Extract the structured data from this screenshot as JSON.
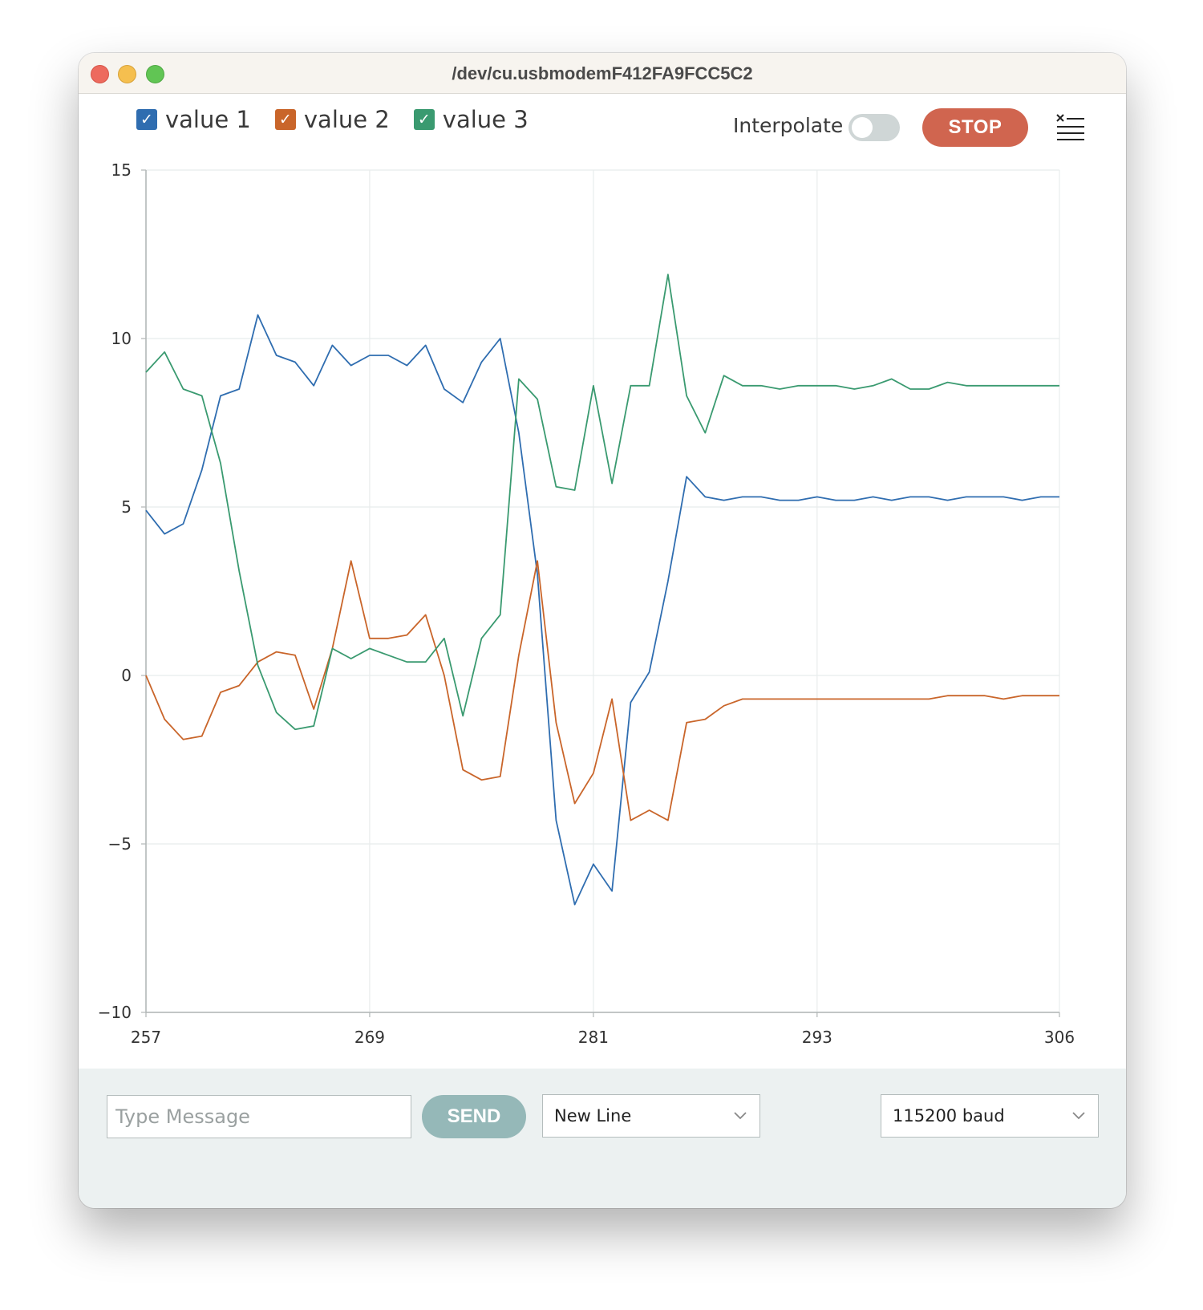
{
  "window": {
    "title": "/dev/cu.usbmodemF412FA9FCC5C2"
  },
  "toolbar": {
    "interpolate_label": "Interpolate",
    "interpolate_on": false,
    "stop_label": "STOP",
    "clear_icon": "clear-list-icon"
  },
  "legend": [
    {
      "label": "value 1",
      "color": "#2f6db0",
      "checked": true
    },
    {
      "label": "value 2",
      "color": "#c9652a",
      "checked": true
    },
    {
      "label": "value 3",
      "color": "#3a9a70",
      "checked": true
    }
  ],
  "chart_data": {
    "type": "line",
    "ylim": [
      -10,
      15
    ],
    "yticks": [
      "15",
      "10",
      "5",
      "0",
      "−10"
    ],
    "ytick_values": [
      15,
      10,
      5,
      0,
      -5,
      -10
    ],
    "ytick_labels": [
      "15",
      "10",
      "5",
      "0",
      "−5",
      "−10"
    ],
    "xlim": [
      257,
      306
    ],
    "xticks": [
      257,
      269,
      281,
      293,
      306
    ],
    "xtick_labels": [
      "257",
      "269",
      "281",
      "293",
      "306"
    ],
    "grid": true,
    "x": [
      257,
      258,
      259,
      260,
      261,
      262,
      263,
      264,
      265,
      266,
      267,
      268,
      269,
      270,
      271,
      272,
      273,
      274,
      275,
      276,
      277,
      278,
      279,
      280,
      281,
      282,
      283,
      284,
      285,
      286,
      287,
      288,
      289,
      290,
      291,
      292,
      293,
      294,
      295,
      296,
      297,
      298,
      299,
      300,
      301,
      302,
      303,
      304,
      305,
      306
    ],
    "series": [
      {
        "name": "value 1",
        "color": "#2f6db0",
        "values": [
          4.9,
          4.2,
          4.5,
          6.1,
          8.3,
          8.5,
          10.7,
          9.5,
          9.3,
          8.6,
          9.8,
          9.2,
          9.5,
          9.5,
          9.2,
          9.8,
          8.5,
          8.1,
          9.3,
          10.0,
          7.2,
          3.0,
          -4.3,
          -6.8,
          -5.6,
          -6.4,
          -0.8,
          0.1,
          2.8,
          5.9,
          5.3,
          5.2,
          5.3,
          5.3,
          5.2,
          5.2,
          5.3,
          5.2,
          5.2,
          5.3,
          5.2,
          5.3,
          5.3,
          5.2,
          5.3,
          5.3,
          5.3,
          5.2,
          5.3,
          5.3
        ]
      },
      {
        "name": "value 2",
        "color": "#c9652a",
        "values": [
          0.0,
          -1.3,
          -1.9,
          -1.8,
          -0.5,
          -0.3,
          0.4,
          0.7,
          0.6,
          -1.0,
          0.8,
          3.4,
          1.1,
          1.1,
          1.2,
          1.8,
          0.0,
          -2.8,
          -3.1,
          -3.0,
          0.6,
          3.4,
          -1.4,
          -3.8,
          -2.9,
          -0.7,
          -4.3,
          -4.0,
          -4.3,
          -1.4,
          -1.3,
          -0.9,
          -0.7,
          -0.7,
          -0.7,
          -0.7,
          -0.7,
          -0.7,
          -0.7,
          -0.7,
          -0.7,
          -0.7,
          -0.7,
          -0.6,
          -0.6,
          -0.6,
          -0.7,
          -0.6,
          -0.6,
          -0.6
        ]
      },
      {
        "name": "value 3",
        "color": "#3a9a70",
        "values": [
          9.0,
          9.6,
          8.5,
          8.3,
          6.3,
          3.1,
          0.3,
          -1.1,
          -1.6,
          -1.5,
          0.8,
          0.5,
          0.8,
          0.6,
          0.4,
          0.4,
          1.1,
          -1.2,
          1.1,
          1.8,
          8.8,
          8.2,
          5.6,
          5.5,
          8.6,
          5.7,
          8.6,
          8.6,
          11.9,
          8.3,
          7.2,
          8.9,
          8.6,
          8.6,
          8.5,
          8.6,
          8.6,
          8.6,
          8.5,
          8.6,
          8.8,
          8.5,
          8.5,
          8.7,
          8.6,
          8.6,
          8.6,
          8.6,
          8.6,
          8.6
        ]
      }
    ]
  },
  "bottom": {
    "message_placeholder": "Type Message",
    "send_label": "SEND",
    "line_ending": "New Line",
    "baud": "115200 baud"
  }
}
